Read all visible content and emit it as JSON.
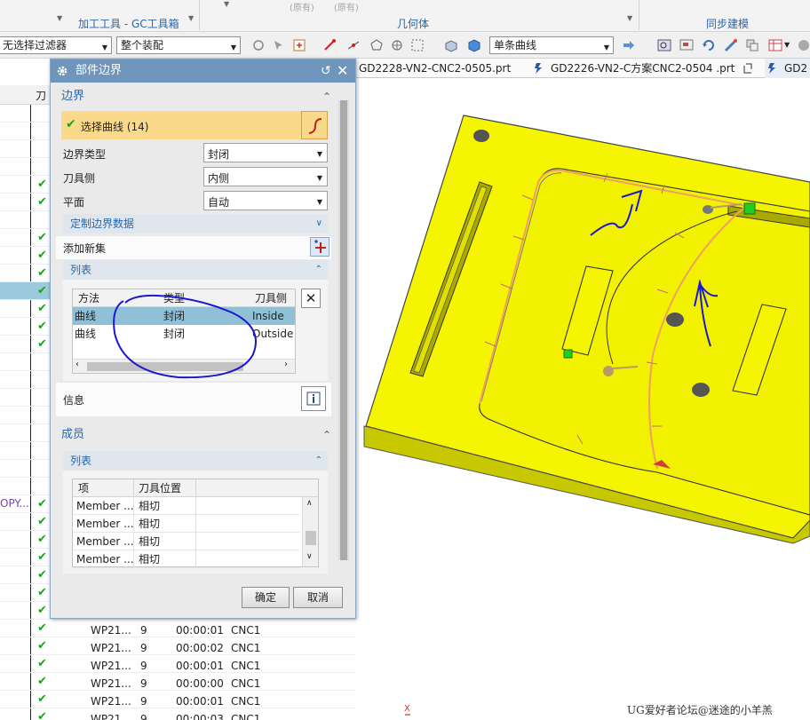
{
  "ribbon": {
    "group_left": "加工工具 - GC工具箱",
    "group_mid": "几何体",
    "group_right": "同步建模",
    "faded_1": "(原有)",
    "faded_2": "(原有)"
  },
  "toolbar": {
    "filter": "无选择过滤器",
    "assembly": "整个装配",
    "curve_rule": "单条曲线"
  },
  "tabs": [
    {
      "label": "GD2228-VN2-CNC2-0505.prt"
    },
    {
      "label": "GD2226-VN2-C方案CNC2-0504 .prt"
    },
    {
      "label": "GD2"
    }
  ],
  "navigator": {
    "header_col": "刀",
    "copy_label": "OPY...",
    "rows": [
      {
        "name": "WP21...",
        "n": "9",
        "time": "00:00:01",
        "mach": "CNC1"
      },
      {
        "name": "WP21...",
        "n": "9",
        "time": "00:00:02",
        "mach": "CNC1"
      },
      {
        "name": "WP21...",
        "n": "9",
        "time": "00:00:01",
        "mach": "CNC1"
      },
      {
        "name": "WP21...",
        "n": "9",
        "time": "00:00:00",
        "mach": "CNC1"
      },
      {
        "name": "WP21...",
        "n": "9",
        "time": "00:00:01",
        "mach": "CNC1"
      },
      {
        "name": "WP21...",
        "n": "9",
        "time": "00:00:03",
        "mach": "CNC1"
      }
    ]
  },
  "dialog": {
    "title": "部件边界",
    "boundary_section": "边界",
    "select_curve": "选择曲线 (14)",
    "boundary_type_label": "边界类型",
    "boundary_type_value": "封闭",
    "tool_side_label": "刀具侧",
    "tool_side_value": "内侧",
    "plane_label": "平面",
    "plane_value": "自动",
    "custom_data": "定制边界数据",
    "add_new_set": "添加新集",
    "list_label": "列表",
    "list_columns": [
      "方法",
      "类型",
      "刀具侧"
    ],
    "list_rows": [
      {
        "method": "曲线",
        "type": "封闭",
        "side": "Inside"
      },
      {
        "method": "曲线",
        "type": "封闭",
        "side": "Outside"
      }
    ],
    "info_label": "信息",
    "members_section": "成员",
    "members_list_label": "列表",
    "members_columns": [
      "项",
      "刀具位置"
    ],
    "members_rows": [
      {
        "item": "Member ...",
        "pos": "相切"
      },
      {
        "item": "Member ...",
        "pos": "相切"
      },
      {
        "item": "Member ...",
        "pos": "相切"
      },
      {
        "item": "Member ...",
        "pos": "相切"
      }
    ],
    "ok": "确定",
    "cancel": "取消"
  },
  "viewport": {
    "axis_label": "X"
  },
  "watermark": "UG爱好者论坛@迷途的小羊羔",
  "colors": {
    "part_yellow": "#f5f500",
    "selection_row": "#8fc0d6",
    "dialog_title": "#6f95bd",
    "accent_blue": "#2a66a8",
    "boundary_orange": "#f0a060",
    "marker_green": "#22cc22",
    "annotation_blue": "#1a1acc"
  }
}
